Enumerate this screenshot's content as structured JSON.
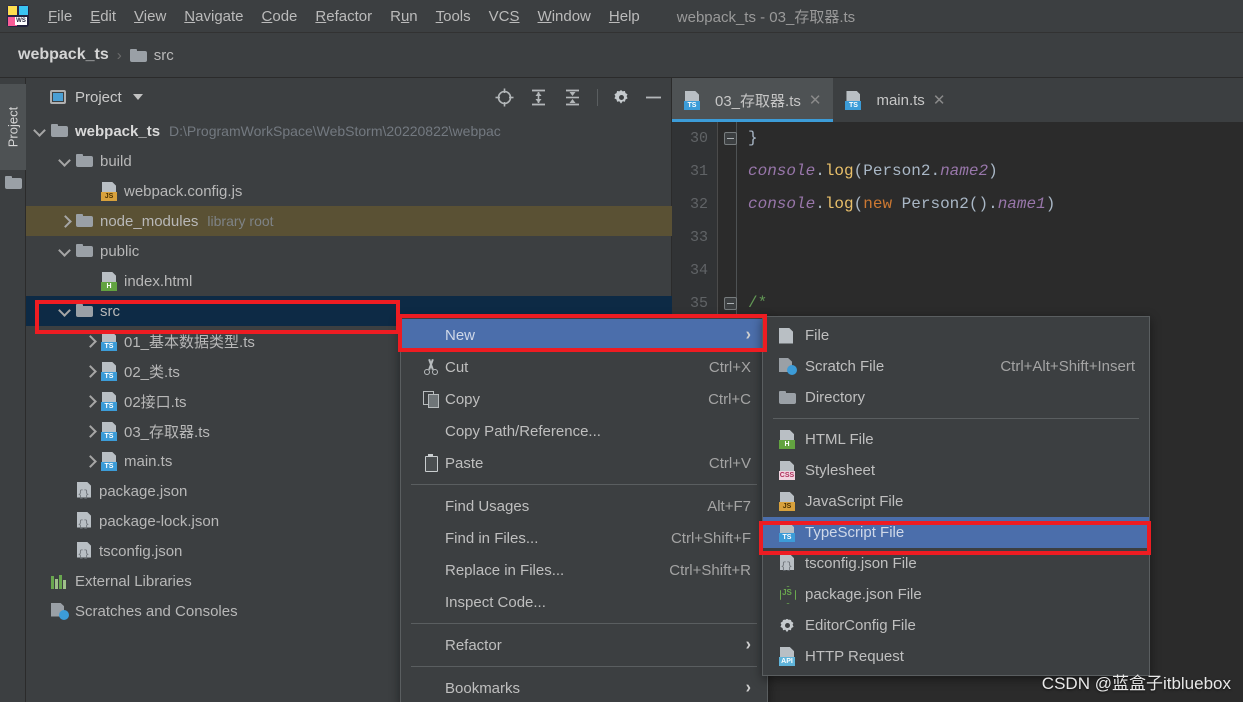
{
  "window": {
    "title": "webpack_ts - 03_存取器.ts",
    "logo_label": "WS"
  },
  "menubar": {
    "items": [
      {
        "label": "File",
        "mnemonic": "F"
      },
      {
        "label": "Edit",
        "mnemonic": "E"
      },
      {
        "label": "View",
        "mnemonic": "V"
      },
      {
        "label": "Navigate",
        "mnemonic": "N"
      },
      {
        "label": "Code",
        "mnemonic": "C"
      },
      {
        "label": "Refactor",
        "mnemonic": "R"
      },
      {
        "label": "Run",
        "mnemonic": "u"
      },
      {
        "label": "Tools",
        "mnemonic": "T"
      },
      {
        "label": "VCS",
        "mnemonic": "S"
      },
      {
        "label": "Window",
        "mnemonic": "W"
      },
      {
        "label": "Help",
        "mnemonic": "H"
      }
    ]
  },
  "breadcrumb": {
    "project": "webpack_ts",
    "separator": "›",
    "current": "src"
  },
  "toolstrip": {
    "project_tab": "Project"
  },
  "project_panel": {
    "header_label": "Project",
    "tools": [
      "locate-icon",
      "expand-all-icon",
      "collapse-all-icon",
      "settings-gear-icon",
      "minimize-icon"
    ],
    "tree": [
      {
        "label": "webpack_ts",
        "hint": "D:\\ProgramWorkSpace\\WebStorm\\20220822\\webpac",
        "icon": "folder",
        "arrow": "down",
        "indent": 0,
        "bold": true,
        "state": "normal"
      },
      {
        "label": "build",
        "hint": "",
        "icon": "folder",
        "arrow": "down",
        "indent": 1,
        "bold": false,
        "state": "normal"
      },
      {
        "label": "webpack.config.js",
        "hint": "",
        "icon": "js",
        "arrow": "none",
        "indent": 2,
        "bold": false,
        "state": "normal"
      },
      {
        "label": "node_modules",
        "hint": "library root",
        "icon": "folder",
        "arrow": "right",
        "indent": 1,
        "bold": false,
        "state": "library"
      },
      {
        "label": "public",
        "hint": "",
        "icon": "folder",
        "arrow": "down",
        "indent": 1,
        "bold": false,
        "state": "normal"
      },
      {
        "label": "index.html",
        "hint": "",
        "icon": "html",
        "arrow": "none",
        "indent": 2,
        "bold": false,
        "state": "normal"
      },
      {
        "label": "src",
        "hint": "",
        "icon": "folder",
        "arrow": "down",
        "indent": 1,
        "bold": false,
        "state": "selected"
      },
      {
        "label": "01_基本数据类型.ts",
        "hint": "",
        "icon": "ts",
        "arrow": "right",
        "indent": 2,
        "bold": false,
        "state": "normal"
      },
      {
        "label": "02_类.ts",
        "hint": "",
        "icon": "ts",
        "arrow": "right",
        "indent": 2,
        "bold": false,
        "state": "normal"
      },
      {
        "label": "02接口.ts",
        "hint": "",
        "icon": "ts",
        "arrow": "right",
        "indent": 2,
        "bold": false,
        "state": "normal"
      },
      {
        "label": "03_存取器.ts",
        "hint": "",
        "icon": "ts",
        "arrow": "right",
        "indent": 2,
        "bold": false,
        "state": "normal"
      },
      {
        "label": "main.ts",
        "hint": "",
        "icon": "ts",
        "arrow": "right",
        "indent": 2,
        "bold": false,
        "state": "normal"
      },
      {
        "label": "package.json",
        "hint": "",
        "icon": "json",
        "arrow": "none",
        "indent": 1,
        "bold": false,
        "state": "normal"
      },
      {
        "label": "package-lock.json",
        "hint": "",
        "icon": "json",
        "arrow": "none",
        "indent": 1,
        "bold": false,
        "state": "normal"
      },
      {
        "label": "tsconfig.json",
        "hint": "",
        "icon": "json",
        "arrow": "none",
        "indent": 1,
        "bold": false,
        "state": "normal"
      },
      {
        "label": "External Libraries",
        "hint": "",
        "icon": "lib",
        "arrow": "none",
        "indent": 0,
        "bold": false,
        "state": "normal"
      },
      {
        "label": "Scratches and Consoles",
        "hint": "",
        "icon": "scratch",
        "arrow": "none",
        "indent": 0,
        "bold": false,
        "state": "normal"
      }
    ]
  },
  "editor": {
    "tabs": [
      {
        "label": "03_存取器.ts",
        "icon": "ts",
        "active": true,
        "close": "✕"
      },
      {
        "label": "main.ts",
        "icon": "ts",
        "active": false,
        "close": "✕"
      }
    ],
    "line_numbers": [
      "30",
      "31",
      "32",
      "33",
      "34",
      "35"
    ],
    "code_lines": [
      {
        "n": "30",
        "tokens": [
          {
            "t": "}",
            "c": "punc"
          }
        ],
        "fold": true
      },
      {
        "n": "31",
        "tokens": [
          {
            "t": "console",
            "c": "console"
          },
          {
            "t": ".",
            "c": "punc"
          },
          {
            "t": "log",
            "c": "fn"
          },
          {
            "t": "(",
            "c": "punc"
          },
          {
            "t": "Person2",
            "c": "ident"
          },
          {
            "t": ".",
            "c": "punc"
          },
          {
            "t": "name2",
            "c": "prop"
          },
          {
            "t": ")",
            "c": "punc"
          }
        ],
        "fold": false
      },
      {
        "n": "32",
        "tokens": [
          {
            "t": "console",
            "c": "console"
          },
          {
            "t": ".",
            "c": "punc"
          },
          {
            "t": "log",
            "c": "fn"
          },
          {
            "t": "(",
            "c": "punc"
          },
          {
            "t": "new ",
            "c": "kw"
          },
          {
            "t": "Person2",
            "c": "ident"
          },
          {
            "t": "().",
            "c": "punc"
          },
          {
            "t": "name1",
            "c": "prop"
          },
          {
            "t": ")",
            "c": "punc"
          }
        ],
        "fold": false
      },
      {
        "n": "33",
        "tokens": [],
        "fold": false
      },
      {
        "n": "34",
        "tokens": [],
        "fold": false
      },
      {
        "n": "35",
        "tokens": [
          {
            "t": "/*",
            "c": "comment"
          }
        ],
        "fold": true
      }
    ]
  },
  "context_menu": {
    "items": [
      {
        "label": "New",
        "accel": "",
        "icon": "",
        "submenu": true,
        "highlight": true,
        "separator_after": false
      },
      {
        "label": "Cut",
        "accel": "Ctrl+X",
        "icon": "cut-icon",
        "submenu": false,
        "highlight": false,
        "separator_after": false
      },
      {
        "label": "Copy",
        "accel": "Ctrl+C",
        "icon": "copy-icon",
        "submenu": false,
        "highlight": false,
        "separator_after": false
      },
      {
        "label": "Copy Path/Reference...",
        "accel": "",
        "icon": "",
        "submenu": false,
        "highlight": false,
        "separator_after": false
      },
      {
        "label": "Paste",
        "accel": "Ctrl+V",
        "icon": "paste-icon",
        "submenu": false,
        "highlight": false,
        "separator_after": true
      },
      {
        "label": "Find Usages",
        "accel": "Alt+F7",
        "icon": "",
        "submenu": false,
        "highlight": false,
        "separator_after": false
      },
      {
        "label": "Find in Files...",
        "accel": "Ctrl+Shift+F",
        "icon": "",
        "submenu": false,
        "highlight": false,
        "separator_after": false
      },
      {
        "label": "Replace in Files...",
        "accel": "Ctrl+Shift+R",
        "icon": "",
        "submenu": false,
        "highlight": false,
        "separator_after": false
      },
      {
        "label": "Inspect Code...",
        "accel": "",
        "icon": "",
        "submenu": false,
        "highlight": false,
        "separator_after": true
      },
      {
        "label": "Refactor",
        "accel": "",
        "icon": "",
        "submenu": true,
        "highlight": false,
        "separator_after": true
      },
      {
        "label": "Bookmarks",
        "accel": "",
        "icon": "",
        "submenu": true,
        "highlight": false,
        "separator_after": false
      }
    ]
  },
  "new_submenu": {
    "items": [
      {
        "label": "File",
        "accel": "",
        "icon": "file-icon",
        "highlight": false,
        "separator_after": false
      },
      {
        "label": "Scratch File",
        "accel": "Ctrl+Alt+Shift+Insert",
        "icon": "scratch-file-icon",
        "highlight": false,
        "separator_after": false
      },
      {
        "label": "Directory",
        "accel": "",
        "icon": "directory-icon",
        "highlight": false,
        "separator_after": true
      },
      {
        "label": "HTML File",
        "accel": "",
        "icon": "html-file-icon",
        "highlight": false,
        "separator_after": false
      },
      {
        "label": "Stylesheet",
        "accel": "",
        "icon": "css-file-icon",
        "highlight": false,
        "separator_after": false
      },
      {
        "label": "JavaScript File",
        "accel": "",
        "icon": "js-file-icon",
        "highlight": false,
        "separator_after": false
      },
      {
        "label": "TypeScript File",
        "accel": "",
        "icon": "ts-file-icon",
        "highlight": true,
        "separator_after": false
      },
      {
        "label": "tsconfig.json File",
        "accel": "",
        "icon": "json-file-icon",
        "highlight": false,
        "separator_after": false
      },
      {
        "label": "package.json File",
        "accel": "",
        "icon": "node-icon",
        "highlight": false,
        "separator_after": false
      },
      {
        "label": "EditorConfig File",
        "accel": "",
        "icon": "gear-icon",
        "highlight": false,
        "separator_after": false
      },
      {
        "label": "HTTP Request",
        "accel": "",
        "icon": "api-file-icon",
        "highlight": false,
        "separator_after": false
      }
    ]
  },
  "watermark": {
    "text": "CSDN @蓝盒子itbluebox"
  },
  "colors": {
    "accent_blue": "#4b6eab",
    "annotation_red": "#ee1c22",
    "library_row": "#5a5134",
    "selected_row": "#0d2a45",
    "tab_underline": "#3c9cd8"
  }
}
